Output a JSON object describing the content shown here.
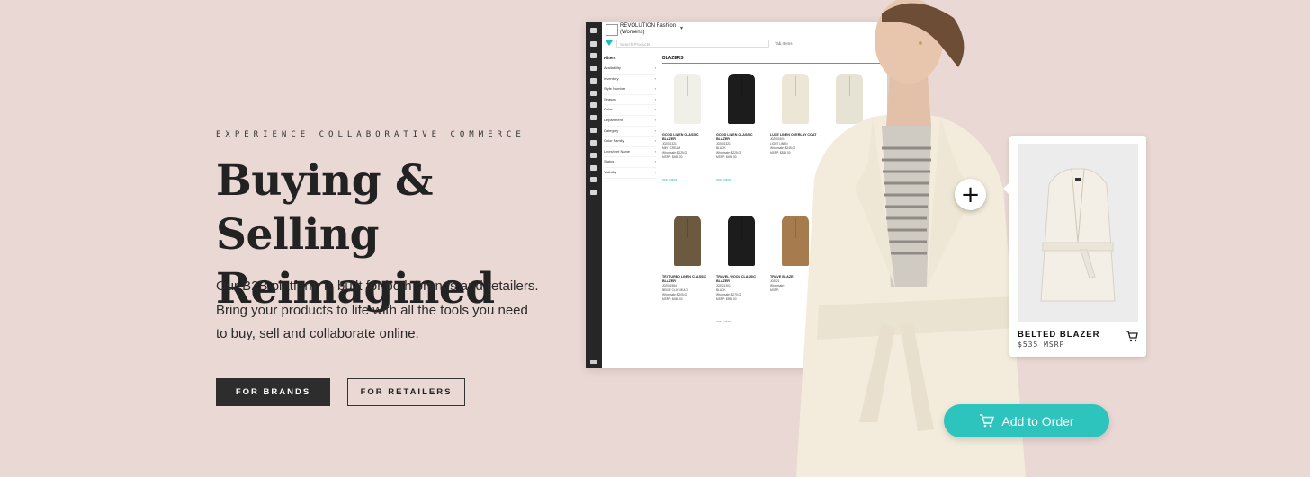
{
  "hero": {
    "eyebrow": "EXPERIENCE COLLABORATIVE COMMERCE",
    "headline_line1": "Buying & Selling",
    "headline_line2": "Reimagined",
    "description": "Our B2B platform is built for both brands and retailers. Bring your products to life with all the tools you need to buy, sell and collaborate online.",
    "btn_brands": "FOR BRANDS",
    "btn_retailers": "FOR RETAILERS"
  },
  "app": {
    "brand_name": "REVOLUTION Fashion (Womens)",
    "search_placeholder": "Search Products",
    "search_value": "Tab,Items",
    "filters_title": "Filters",
    "filters": [
      "Availability",
      "Inventory",
      "Style Number",
      "Season",
      "Color",
      "Department",
      "Category",
      "Color Family",
      "Linesheet Name",
      "Status",
      "Visibility"
    ],
    "grid_title": "BLAZERS",
    "products": [
      {
        "name": "GOOD LINEN CLASSIC BLAZER",
        "sku": "J02001321",
        "color": "MINT CREAM",
        "wholesale": "Wholesale: $225.00",
        "msrp": "MSRP: $495.00",
        "more": "more colors",
        "swatch": "#f1f0e8"
      },
      {
        "name": "GOOD LINEN CLASSIC BLAZER",
        "sku": "J02001321",
        "color": "BLACK",
        "wholesale": "Wholesale: $225.00",
        "msrp": "MSRP: $495.00",
        "more": "more colors",
        "swatch": "#1c1c1c"
      },
      {
        "name": "LUXE LINEN OVERLAY COAT",
        "sku": "J02001501",
        "color": "LIGHT LINEN",
        "wholesale": "Wholesale: $245.00",
        "msrp": "MSRP: $535.00",
        "more": "",
        "swatch": "#ece6d6"
      },
      {
        "name": "",
        "sku": "",
        "color": "",
        "wholesale": "",
        "msrp": "",
        "more": "",
        "swatch": "#e6e2d4"
      },
      {
        "name": "TEXTURED LINEN CLASSIC BLAZER",
        "sku": "J02001584",
        "color": "BEIGE CLAY MULTI",
        "wholesale": "Wholesale: $205.00",
        "msrp": "MSRP: $455.00",
        "more": "",
        "swatch": "#6b5a3f"
      },
      {
        "name": "TRAVEL WOOL CLASSIC BLAZER",
        "sku": "J02021301",
        "color": "BLACK",
        "wholesale": "Wholesale: $270.00",
        "msrp": "MSRP: $595.00",
        "more": "more colors",
        "swatch": "#1c1c1c"
      },
      {
        "name": "TRAVE BLAZE",
        "sku": "J02021",
        "color": "",
        "wholesale": "Wholesale:",
        "msrp": "MSRP:",
        "more": "",
        "swatch": "#a67c4e"
      }
    ]
  },
  "card": {
    "name": "BELTED BLAZER",
    "price": "$535 MSRP"
  },
  "add_to_order": "Add to Order",
  "colors": {
    "accent": "#2cc4bd",
    "background": "#ead8d4",
    "dark": "#2d2d2d"
  }
}
